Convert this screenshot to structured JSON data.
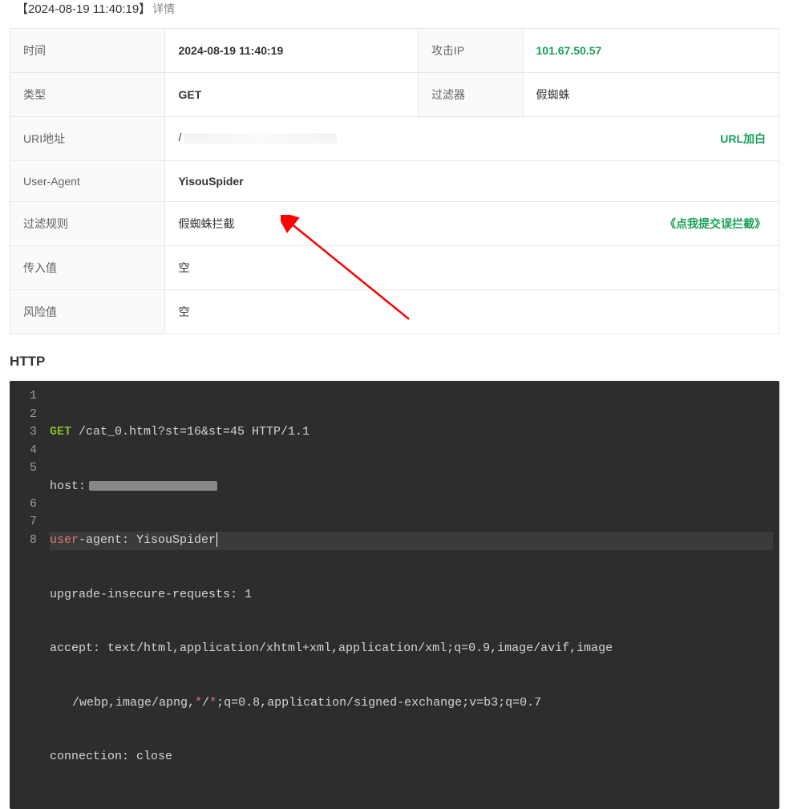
{
  "header": {
    "timestamp": "【2024-08-19 11:40:19】",
    "detail_label": "详情"
  },
  "table": {
    "time": {
      "label": "时间",
      "value": "2024-08-19 11:40:19"
    },
    "ip": {
      "label": "攻击IP",
      "value": "101.67.50.57"
    },
    "type": {
      "label": "类型",
      "value": "GET"
    },
    "filter": {
      "label": "过滤器",
      "value": "假蜘蛛"
    },
    "uri": {
      "label": "URI地址",
      "value": "/",
      "whitelist": "URL加白"
    },
    "ua": {
      "label": "User-Agent",
      "value": "YisouSpider"
    },
    "rule": {
      "label": "过滤规则",
      "value": "假蜘蛛拦截",
      "submit": "《点我提交误拦截》"
    },
    "incoming": {
      "label": "传入值",
      "value": "空"
    },
    "risk": {
      "label": "风险值",
      "value": "空"
    }
  },
  "http": {
    "title": "HTTP",
    "code": {
      "line1_method": "GET",
      "line1_path": " /cat_0.html?st=16&st=45 HTTP/1.1",
      "line2": "host:",
      "line3_user": "user",
      "line3_rest": "-agent: YisouSpider",
      "line4": "upgrade-insecure-requests: 1",
      "line5a": "accept: text/html,application/xhtml+xml,application/xml;q=0.9,image/avif,image",
      "line5b_pre": "/webp,image/apng,",
      "line5b_star1": "*",
      "line5b_slash": "/",
      "line5b_star2": "*",
      "line5b_post": ";q=0.8,application/signed-exchange;v=b3;q=0.7",
      "line6": "connection: close"
    },
    "gutter": [
      "1",
      "2",
      "3",
      "4",
      "5",
      "6",
      "7",
      "8"
    ]
  }
}
